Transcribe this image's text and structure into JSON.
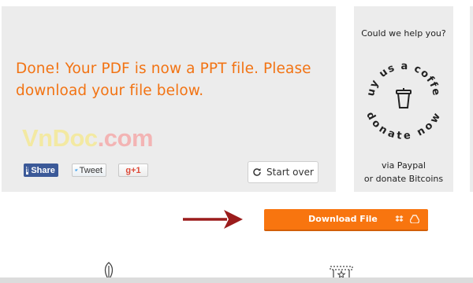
{
  "main": {
    "message": "Done! Your PDF is now a PPT file. Please download your file below.",
    "watermark_part1": "VnDoc",
    "watermark_part2": ".com",
    "share": {
      "facebook_icon": "f",
      "facebook": "Share",
      "twitter": "Tweet",
      "google": "g+1"
    },
    "start_over": "Start over"
  },
  "sidebar": {
    "question": "Could we help you?",
    "coffee_top": "buy us a coffee",
    "coffee_bottom": "donate now",
    "via_paypal": "via Paypal",
    "donate_bitcoins": "or donate Bitcoins"
  },
  "download": {
    "label": "Download File"
  },
  "colors": {
    "accent": "#f8750f",
    "message": "#f27313",
    "panel": "#ececec",
    "arrow": "#9b1c1c"
  },
  "icons": [
    "facebook-icon",
    "twitter-bird-icon",
    "refresh-icon",
    "coffee-cup-icon",
    "arrow-right-icon",
    "dropbox-icon",
    "google-drive-icon"
  ]
}
